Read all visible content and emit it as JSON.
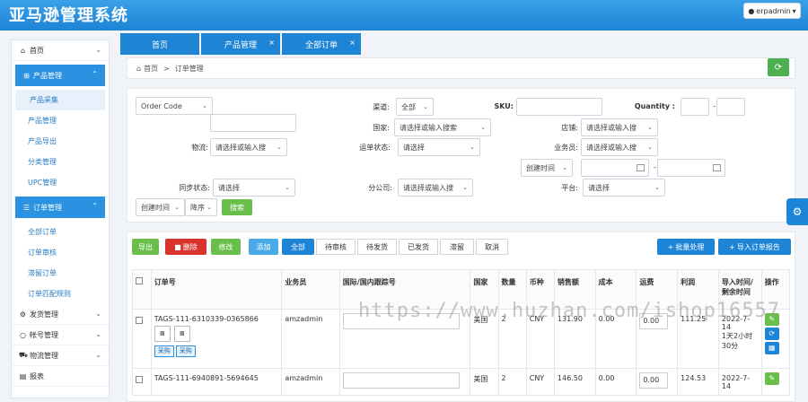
{
  "app": {
    "title": "亚马逊管理系统",
    "user": "erpadmin"
  },
  "sidebar": {
    "items": [
      {
        "icon": "home-icon",
        "label": "首页"
      },
      {
        "icon": "grid-icon",
        "label": "产品管理"
      },
      {
        "label": "产品采集"
      },
      {
        "label": "产品管理"
      },
      {
        "label": "产品导出"
      },
      {
        "label": "分类管理"
      },
      {
        "label": "UPC管理"
      },
      {
        "icon": "list-icon",
        "label": "订单管理"
      },
      {
        "label": "全部订单"
      },
      {
        "label": "订单审核"
      },
      {
        "label": "滞留订单"
      },
      {
        "label": "订单匹配规则"
      },
      {
        "icon": "settings-icon",
        "label": "发货管理"
      },
      {
        "icon": "user-icon",
        "label": "帐号管理"
      },
      {
        "icon": "truck-icon",
        "label": "物流管理"
      },
      {
        "icon": "chart-icon",
        "label": "报表"
      }
    ]
  },
  "tabs": [
    {
      "label": "首页"
    },
    {
      "label": "产品管理",
      "close": "×"
    },
    {
      "label": "全部订单",
      "close": "×"
    }
  ],
  "breadcrumb": {
    "home": "首页",
    "sep": ">",
    "current": "订单管理"
  },
  "filters": {
    "order_code": "Order Code",
    "colon": ":",
    "channel_label": "渠道:",
    "channel_value": "全部",
    "sku_label": "SKU:",
    "quantity_label": "Quantity :",
    "quantity_sep": "-",
    "country_label": "国家:",
    "country_value": "请选择或输入搜索",
    "shop_label": "店铺:",
    "shop_value": "请选择或输入搜",
    "logistics_label": "物流:",
    "logistics_value": "请选择或输入搜",
    "ship_status_label": "运单状态:",
    "ship_status_value": "请选择",
    "salesman_label": "业务员:",
    "salesman_value": "请选择或输入搜",
    "time_type": "创建时间",
    "date_sep": "-",
    "sync_label": "同步状态:",
    "sync_value": "请选择",
    "branch_label": "分公司:",
    "branch_value": "请选择或输入搜",
    "platform_label": "平台:",
    "platform_value": "请选择",
    "sort_field": "创建时间",
    "sort_order": "降序",
    "search_button": "搜索"
  },
  "toolbar": {
    "export": "导出",
    "delete": "删除",
    "edit": "修改",
    "add": "添加",
    "status_tabs": [
      "全部",
      "待审核",
      "待发货",
      "已发货",
      "滞留",
      "取消"
    ],
    "batch": "批量处理",
    "import": "导入订单报告"
  },
  "table": {
    "headers": [
      "订单号",
      "业务员",
      "国际/国内跟踪号",
      "国家",
      "数量",
      "币种",
      "销售额",
      "成本",
      "运费",
      "利润",
      "导入时间/剩余时间",
      "操作"
    ],
    "rows": [
      {
        "order_no": "TAGS-111-6310339-0365866",
        "salesman": "amzadmin",
        "country": "美国",
        "qty": "2",
        "currency": "CNY",
        "sales": "131.90",
        "cost": "0.00",
        "freight": "0.00",
        "profit": "111.25",
        "time": "2022-7-14",
        "remain": "1天2小时30分",
        "tags": [
          "采购",
          "采购"
        ]
      },
      {
        "order_no": "TAGS-111-6940891-5694645",
        "salesman": "amzadmin",
        "country": "美国",
        "qty": "2",
        "currency": "CNY",
        "sales": "146.50",
        "cost": "0.00",
        "freight": "0.00",
        "profit": "124.53",
        "time": "2022-7-14",
        "remain": "",
        "tags": []
      }
    ]
  },
  "watermark": "https://www.huzhan.com/ishop16557",
  "colors": {
    "primary": "#1d84d6",
    "green": "#4caf50",
    "red": "#d9342b",
    "lightgreen": "#6abf4b"
  }
}
